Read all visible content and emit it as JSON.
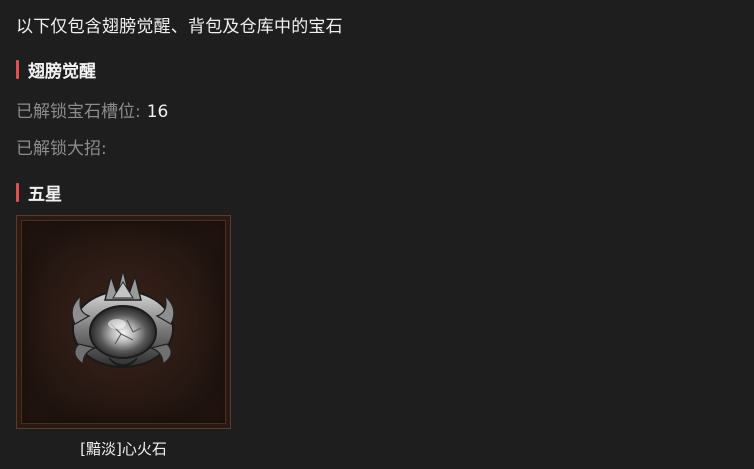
{
  "intro": "以下仅包含翅膀觉醒、背包及仓库中的宝石",
  "wing_section": {
    "title": "翅膀觉醒",
    "unlocked_slots_label": "已解锁宝石槽位:",
    "unlocked_slots_value": "16",
    "unlocked_ult_label": "已解锁大招:",
    "unlocked_ult_value": ""
  },
  "five_star_section": {
    "title": "五星",
    "gems": [
      {
        "name": "[黯淡]心火石",
        "icon": "heartfire-stone-icon"
      }
    ]
  },
  "colors": {
    "background": "#1e1e1e",
    "accent_bar": "#e05050",
    "muted_label": "#8c8c8c",
    "frame_border": "#5a3a2c"
  }
}
